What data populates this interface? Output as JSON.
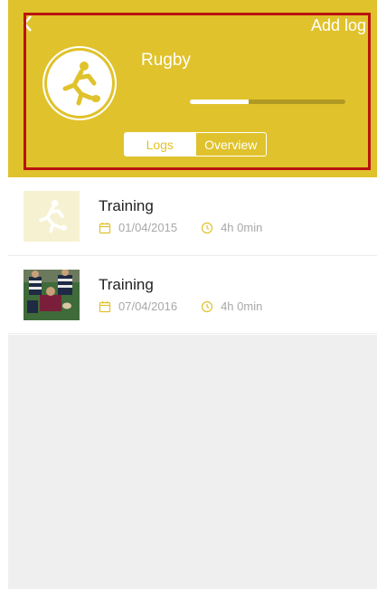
{
  "header": {
    "add_log_label": "Add log",
    "sport_name": "Rugby",
    "progress_fraction": 0.38,
    "accent_color": "#e0c22c",
    "tabs": [
      {
        "label": "Logs",
        "active": true
      },
      {
        "label": "Overview",
        "active": false
      }
    ],
    "icons": {
      "back": "chevron-left-icon",
      "avatar": "rugby-player-icon"
    }
  },
  "logs": [
    {
      "title": "Training",
      "date": "01/04/2015",
      "duration": "4h 0min",
      "thumbnail": "rugby-player-icon"
    },
    {
      "title": "Training",
      "date": "07/04/2016",
      "duration": "4h 0min",
      "thumbnail": "rugby-photo"
    }
  ]
}
